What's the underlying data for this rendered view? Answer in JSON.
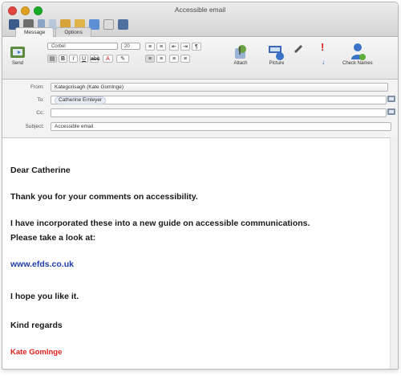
{
  "window": {
    "title": "Accessible email"
  },
  "tabs": [
    {
      "label": "Message"
    },
    {
      "label": "Options"
    }
  ],
  "ribbon": {
    "send_label": "Send",
    "font_name": "Corbel",
    "font_size": "20",
    "attach_label": "Attach",
    "picture_label": "Picture",
    "check_names_label": "Check Names"
  },
  "header": {
    "from_label": "From:",
    "from_value": "Kategorisagh (Kate Gomlnge)",
    "to_label": "To:",
    "to_token": "Catherine Ernleyer",
    "cc_label": "Cc:",
    "subject_label": "Subject:",
    "subject_value": "Accessible email"
  },
  "message": {
    "greeting": "Dear Catherine",
    "line1": "Thank you for your comments on accessibility.",
    "line2a": "I have incorporated these into a new guide on accessible communications.",
    "line2b": "Please take a look at:",
    "link": "www.efds.co.uk",
    "line3": "I hope you like it.",
    "closing": "Kind regards",
    "signature": "Kate Gomlnge"
  },
  "colors": {
    "link": "#1f3ea8",
    "signature": "#e0201c",
    "accent": "#3a73c8"
  }
}
